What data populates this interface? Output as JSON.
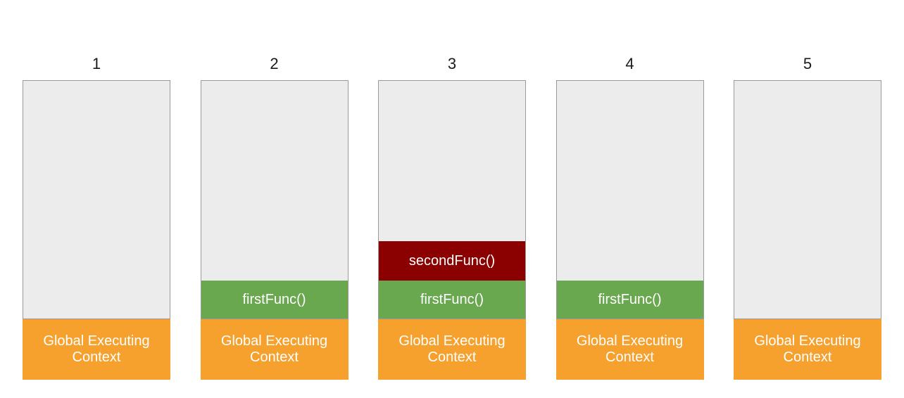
{
  "diagram": {
    "labels": {
      "global": "Global Executing Context",
      "first": "firstFunc()",
      "second": "secondFunc()"
    },
    "steps": [
      {
        "number": "1",
        "frames": [
          "global"
        ]
      },
      {
        "number": "2",
        "frames": [
          "first",
          "global"
        ]
      },
      {
        "number": "3",
        "frames": [
          "second",
          "first",
          "global"
        ]
      },
      {
        "number": "4",
        "frames": [
          "first",
          "global"
        ]
      },
      {
        "number": "5",
        "frames": [
          "global"
        ]
      }
    ],
    "colors": {
      "global": "#f6a12e",
      "first": "#6aa84f",
      "second": "#8b0000",
      "empty": "#ececec",
      "border": "#9a9a9a"
    }
  }
}
